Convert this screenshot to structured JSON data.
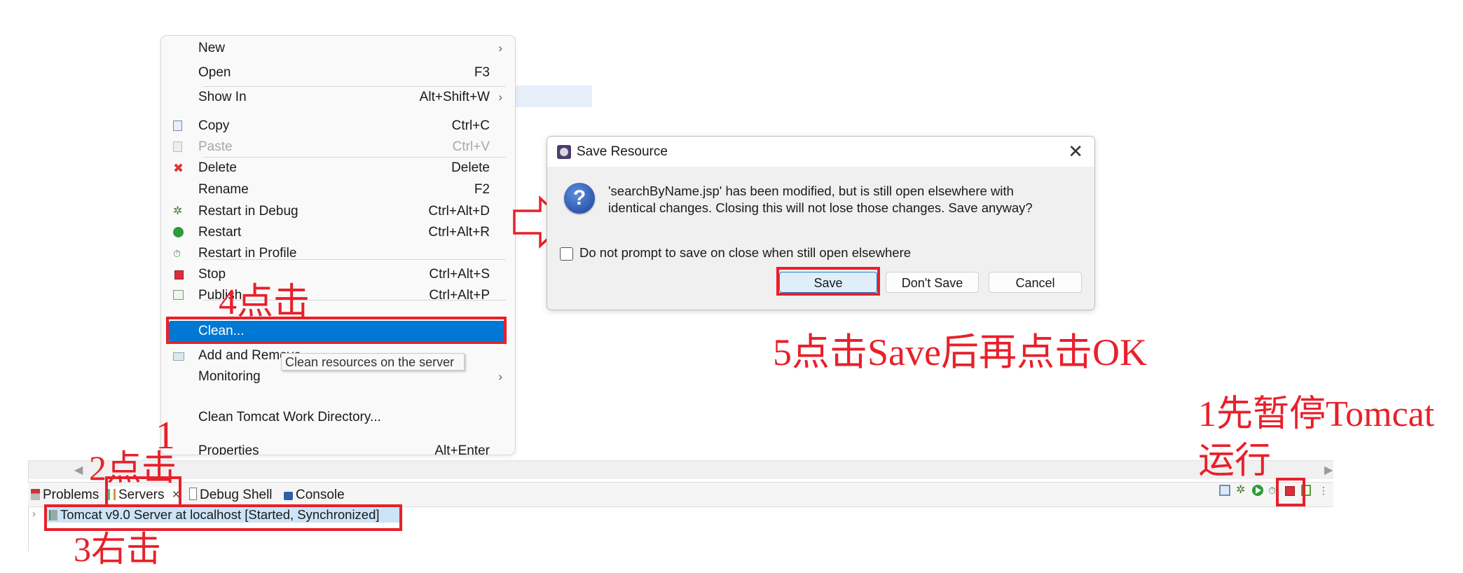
{
  "context_menu": {
    "items": [
      {
        "label": "New",
        "shortcut": "",
        "submenu": true,
        "icon": ""
      },
      {
        "label": "Open",
        "shortcut": "F3",
        "submenu": false,
        "icon": ""
      },
      {
        "label": "Show In",
        "shortcut": "Alt+Shift+W",
        "submenu": true,
        "icon": ""
      },
      {
        "label": "Copy",
        "shortcut": "Ctrl+C",
        "submenu": false,
        "icon": "copy-icon"
      },
      {
        "label": "Paste",
        "shortcut": "Ctrl+V",
        "submenu": false,
        "icon": "paste-icon",
        "disabled": true
      },
      {
        "label": "Delete",
        "shortcut": "Delete",
        "submenu": false,
        "icon": "delete-icon"
      },
      {
        "label": "Rename",
        "shortcut": "F2",
        "submenu": false,
        "icon": ""
      },
      {
        "label": "Restart in Debug",
        "shortcut": "Ctrl+Alt+D",
        "submenu": false,
        "icon": "debug-bug-icon"
      },
      {
        "label": "Restart",
        "shortcut": "Ctrl+Alt+R",
        "submenu": false,
        "icon": "restart-icon"
      },
      {
        "label": "Restart in Profile",
        "shortcut": "",
        "submenu": false,
        "icon": "profile-icon"
      },
      {
        "label": "Stop",
        "shortcut": "Ctrl+Alt+S",
        "submenu": false,
        "icon": "stop-icon"
      },
      {
        "label": "Publish",
        "shortcut": "Ctrl+Alt+P",
        "submenu": false,
        "icon": "publish-icon"
      },
      {
        "label": "Clean...",
        "shortcut": "",
        "submenu": false,
        "icon": "",
        "active": true
      },
      {
        "label": "Add and Remove...",
        "shortcut": "",
        "submenu": false,
        "icon": "add-remove-icon"
      },
      {
        "label": "Monitoring",
        "shortcut": "",
        "submenu": true,
        "icon": ""
      },
      {
        "label": "Clean Tomcat Work Directory...",
        "shortcut": "",
        "submenu": false,
        "icon": ""
      },
      {
        "label": "Properties",
        "shortcut": "Alt+Enter",
        "submenu": false,
        "icon": ""
      }
    ],
    "tooltip": "Clean resources on the server"
  },
  "dialog": {
    "title": "Save Resource",
    "message_line1": "'searchByName.jsp' has been modified, but is still open elsewhere with",
    "message_line2": "identical changes. Closing this will not lose those changes. Save anyway?",
    "checkbox_label": "Do not prompt to save on close when still open elsewhere",
    "checkbox_checked": false,
    "buttons": {
      "save": "Save",
      "dont_save": "Don't Save",
      "cancel": "Cancel"
    }
  },
  "bottom_panel": {
    "tabs": [
      {
        "label": "Problems",
        "icon": "problems-icon"
      },
      {
        "label": "Servers",
        "icon": "servers-icon",
        "selected": true
      },
      {
        "label": "Debug Shell",
        "icon": "debug-shell-icon"
      },
      {
        "label": "Console",
        "icon": "console-icon"
      }
    ],
    "close_glyph": "×",
    "server_row": "Tomcat v9.0 Server at localhost  [Started, Synchronized]",
    "toolbar_icons": [
      "collapse-all-icon",
      "debug-icon",
      "start-icon",
      "profile-icon",
      "stop-icon",
      "publish-icon",
      "view-menu-icon"
    ]
  },
  "annotations": {
    "step1": "1先暂停Tomcat",
    "step1_line2": "运行",
    "step2": "2点击",
    "step2_extra": "1",
    "step3": "3右击",
    "step4": "4点击",
    "step5": "5点击Save后再点击OK"
  },
  "colors": {
    "annotation_red": "#e8202a",
    "selection_blue": "#0078d4",
    "row_highlight": "#cce4f7"
  }
}
